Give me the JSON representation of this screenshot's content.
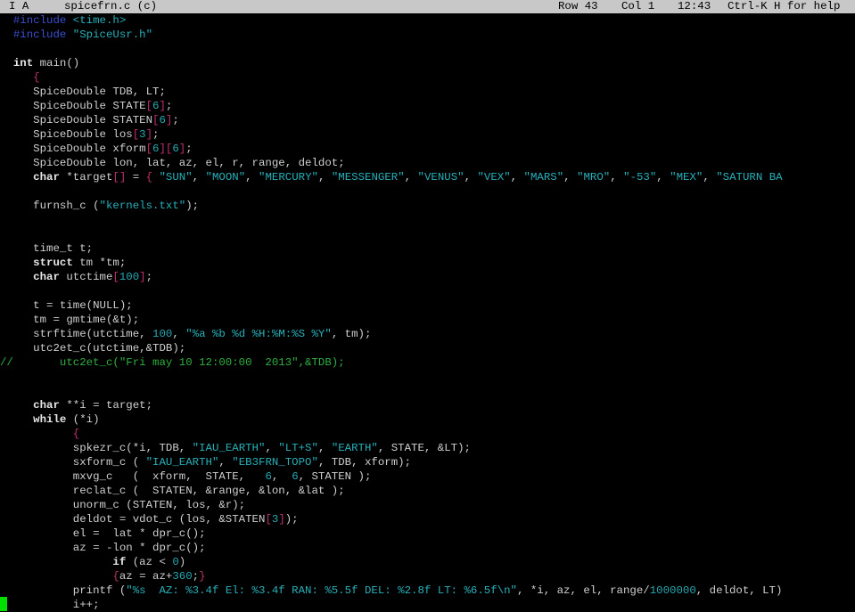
{
  "status_bar": {
    "mode": "I A",
    "filename": "spicefrn.c (c)",
    "row": "Row 43",
    "col": "Col 1",
    "time": "12:43",
    "help": "Ctrl-K H for help"
  },
  "code_lines": [
    [
      [
        "inc",
        "  #include "
      ],
      [
        "str",
        "<time.h>"
      ]
    ],
    [
      [
        "inc",
        "  #include "
      ],
      [
        "str",
        "\"SpiceUsr.h\""
      ]
    ],
    [
      [
        "txt",
        ""
      ]
    ],
    [
      [
        "kw",
        "  int"
      ],
      [
        "txt",
        " main()"
      ]
    ],
    [
      [
        "br",
        "     {"
      ]
    ],
    [
      [
        "txt",
        "     SpiceDouble TDB, LT;"
      ]
    ],
    [
      [
        "txt",
        "     SpiceDouble STATE"
      ],
      [
        "br",
        "["
      ],
      [
        "num",
        "6"
      ],
      [
        "br",
        "]"
      ],
      [
        "txt",
        ";"
      ]
    ],
    [
      [
        "txt",
        "     SpiceDouble STATEN"
      ],
      [
        "br",
        "["
      ],
      [
        "num",
        "6"
      ],
      [
        "br",
        "]"
      ],
      [
        "txt",
        ";"
      ]
    ],
    [
      [
        "txt",
        "     SpiceDouble los"
      ],
      [
        "br",
        "["
      ],
      [
        "num",
        "3"
      ],
      [
        "br",
        "]"
      ],
      [
        "txt",
        ";"
      ]
    ],
    [
      [
        "txt",
        "     SpiceDouble xform"
      ],
      [
        "br",
        "["
      ],
      [
        "num",
        "6"
      ],
      [
        "br",
        "]["
      ],
      [
        "num",
        "6"
      ],
      [
        "br",
        "]"
      ],
      [
        "txt",
        ";"
      ]
    ],
    [
      [
        "txt",
        "     SpiceDouble lon, lat, az, el, r, range, deldot;"
      ]
    ],
    [
      [
        "kw",
        "     char"
      ],
      [
        "txt",
        " *target"
      ],
      [
        "br",
        "[]"
      ],
      [
        "txt",
        " = "
      ],
      [
        "br",
        "{"
      ],
      [
        "txt",
        " "
      ],
      [
        "str",
        "\"SUN\""
      ],
      [
        "txt",
        ", "
      ],
      [
        "str",
        "\"MOON\""
      ],
      [
        "txt",
        ", "
      ],
      [
        "str",
        "\"MERCURY\""
      ],
      [
        "txt",
        ", "
      ],
      [
        "str",
        "\"MESSENGER\""
      ],
      [
        "txt",
        ", "
      ],
      [
        "str",
        "\"VENUS\""
      ],
      [
        "txt",
        ", "
      ],
      [
        "str",
        "\"VEX\""
      ],
      [
        "txt",
        ", "
      ],
      [
        "str",
        "\"MARS\""
      ],
      [
        "txt",
        ", "
      ],
      [
        "str",
        "\"MRO\""
      ],
      [
        "txt",
        ", "
      ],
      [
        "str",
        "\"-53\""
      ],
      [
        "txt",
        ", "
      ],
      [
        "str",
        "\"MEX\""
      ],
      [
        "txt",
        ", "
      ],
      [
        "str",
        "\"SATURN BA"
      ]
    ],
    [
      [
        "txt",
        ""
      ]
    ],
    [
      [
        "txt",
        "     furnsh_c ("
      ],
      [
        "str",
        "\"kernels.txt\""
      ],
      [
        "txt",
        ");"
      ]
    ],
    [
      [
        "txt",
        ""
      ]
    ],
    [
      [
        "txt",
        ""
      ]
    ],
    [
      [
        "txt",
        "     time_t t;"
      ]
    ],
    [
      [
        "kw",
        "     struct"
      ],
      [
        "txt",
        " tm *tm;"
      ]
    ],
    [
      [
        "kw",
        "     char"
      ],
      [
        "txt",
        " utctime"
      ],
      [
        "br",
        "["
      ],
      [
        "num",
        "100"
      ],
      [
        "br",
        "]"
      ],
      [
        "txt",
        ";"
      ]
    ],
    [
      [
        "txt",
        ""
      ]
    ],
    [
      [
        "txt",
        "     t = time(NULL);"
      ]
    ],
    [
      [
        "txt",
        "     tm = gmtime(&t);"
      ]
    ],
    [
      [
        "txt",
        "     strftime(utctime, "
      ],
      [
        "num",
        "100"
      ],
      [
        "txt",
        ", "
      ],
      [
        "str",
        "\"%a %b %d %H:%M:%S %Y\""
      ],
      [
        "txt",
        ", tm);"
      ]
    ],
    [
      [
        "txt",
        "     utc2et_c(utctime,&TDB);"
      ]
    ],
    [
      [
        "cmt",
        "//       utc2et_c(\"Fri may 10 12:00:00  2013\",&TDB);"
      ]
    ],
    [
      [
        "txt",
        ""
      ]
    ],
    [
      [
        "txt",
        ""
      ]
    ],
    [
      [
        "kw",
        "     char"
      ],
      [
        "txt",
        " **i = target;"
      ]
    ],
    [
      [
        "kw",
        "     while"
      ],
      [
        "txt",
        " (*i)"
      ]
    ],
    [
      [
        "br",
        "           {"
      ]
    ],
    [
      [
        "txt",
        "           spkezr_c(*i, TDB, "
      ],
      [
        "str",
        "\"IAU_EARTH\""
      ],
      [
        "txt",
        ", "
      ],
      [
        "str",
        "\"LT+S\""
      ],
      [
        "txt",
        ", "
      ],
      [
        "str",
        "\"EARTH\""
      ],
      [
        "txt",
        ", STATE, &LT);"
      ]
    ],
    [
      [
        "txt",
        "           sxform_c ( "
      ],
      [
        "str",
        "\"IAU_EARTH\""
      ],
      [
        "txt",
        ", "
      ],
      [
        "str",
        "\"EB3FRN_TOPO\""
      ],
      [
        "txt",
        ", TDB, xform);"
      ]
    ],
    [
      [
        "txt",
        "           mxvg_c   (  xform,  STATE,   "
      ],
      [
        "num",
        "6"
      ],
      [
        "txt",
        ",  "
      ],
      [
        "num",
        "6"
      ],
      [
        "txt",
        ", STATEN );"
      ]
    ],
    [
      [
        "txt",
        "           reclat_c (  STATEN, &range, &lon, &lat );"
      ]
    ],
    [
      [
        "txt",
        "           unorm_c (STATEN, los, &r);"
      ]
    ],
    [
      [
        "txt",
        "           deldot = vdot_c (los, &STATEN"
      ],
      [
        "br",
        "["
      ],
      [
        "num",
        "3"
      ],
      [
        "br",
        "]"
      ],
      [
        "txt",
        ");"
      ]
    ],
    [
      [
        "txt",
        "           el =  lat * dpr_c();"
      ]
    ],
    [
      [
        "txt",
        "           az = -lon * dpr_c();"
      ]
    ],
    [
      [
        "kw",
        "                 if"
      ],
      [
        "txt",
        " (az < "
      ],
      [
        "num",
        "0"
      ],
      [
        "txt",
        ")"
      ]
    ],
    [
      [
        "br",
        "                 {"
      ],
      [
        "txt",
        "az = az+"
      ],
      [
        "num",
        "360"
      ],
      [
        "txt",
        ";"
      ],
      [
        "br",
        "}"
      ]
    ],
    [
      [
        "txt",
        "           printf ("
      ],
      [
        "str",
        "\"%s  AZ: %3.4f El: %3.4f RAN: %5.5f DEL: %2.8f LT: %6.5f\\n\""
      ],
      [
        "txt",
        ", *i, az, el, range/"
      ],
      [
        "num",
        "1000000"
      ],
      [
        "txt",
        ", deldot, LT)"
      ]
    ],
    [
      [
        "txt",
        "           i++;"
      ]
    ]
  ]
}
